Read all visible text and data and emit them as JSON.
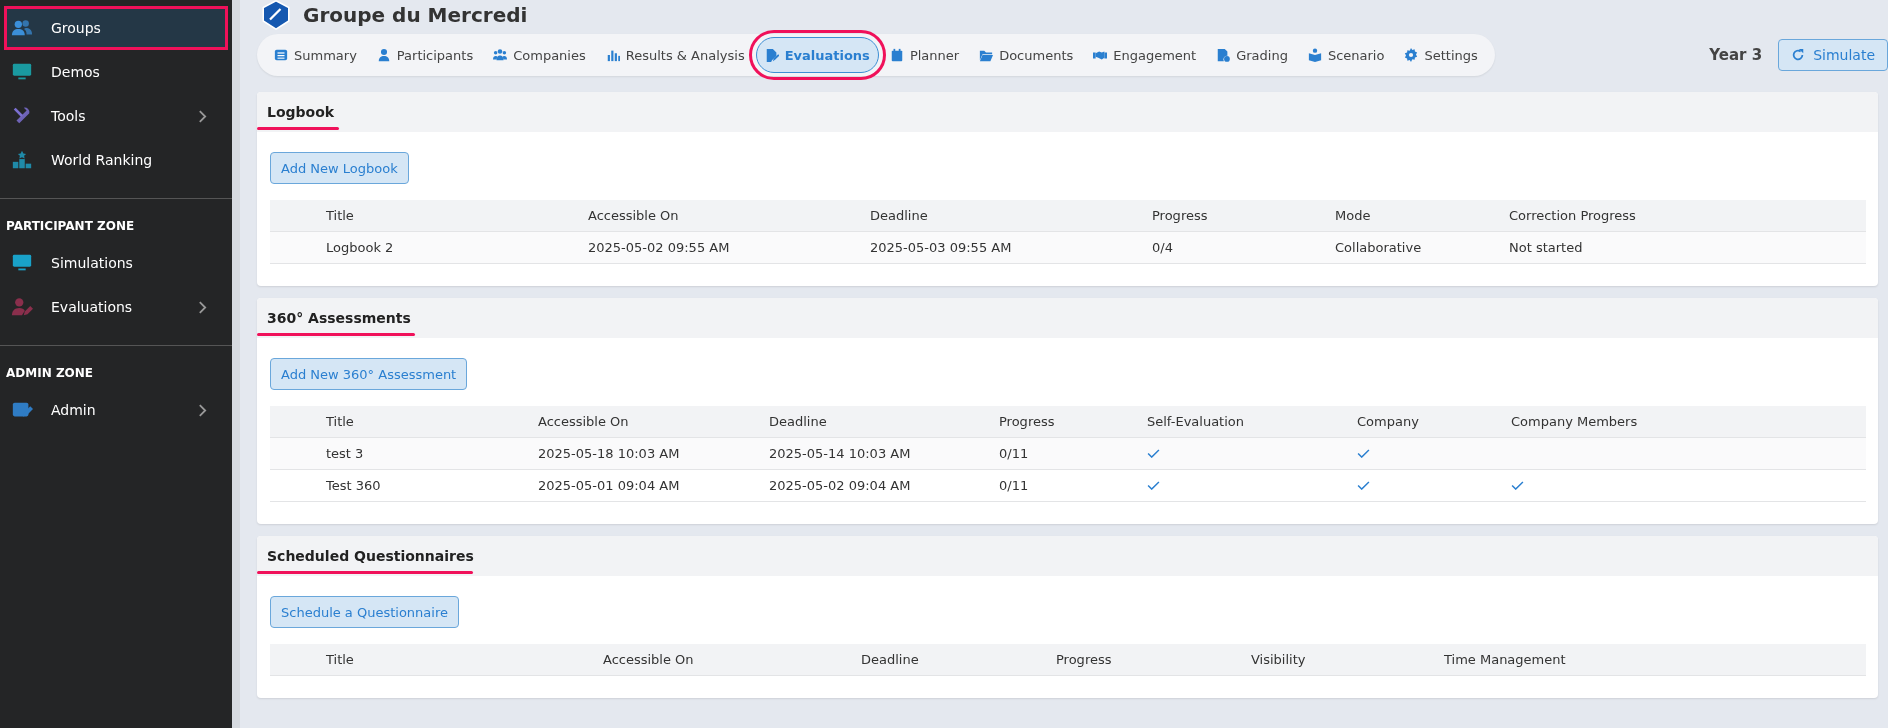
{
  "sidebar": {
    "sections": [
      {
        "items": [
          {
            "label": "Groups",
            "selected": true,
            "highlighted": true,
            "has_submenu": false
          },
          {
            "label": "Demos",
            "selected": false,
            "highlighted": false,
            "has_submenu": false
          },
          {
            "label": "Tools",
            "selected": false,
            "highlighted": false,
            "has_submenu": true
          },
          {
            "label": "World Ranking",
            "selected": false,
            "highlighted": false,
            "has_submenu": false
          }
        ]
      },
      {
        "heading": "PARTICIPANT ZONE",
        "items": [
          {
            "label": "Simulations",
            "selected": false,
            "highlighted": false,
            "has_submenu": false
          },
          {
            "label": "Evaluations",
            "selected": false,
            "highlighted": false,
            "has_submenu": true
          }
        ]
      },
      {
        "heading": "ADMIN ZONE",
        "items": [
          {
            "label": "Admin",
            "selected": false,
            "highlighted": false,
            "has_submenu": true
          }
        ]
      }
    ]
  },
  "header": {
    "title": "Groupe du Mercredi"
  },
  "tabs": [
    {
      "label": "Summary",
      "selected": false,
      "highlighted": false
    },
    {
      "label": "Participants",
      "selected": false,
      "highlighted": false
    },
    {
      "label": "Companies",
      "selected": false,
      "highlighted": false
    },
    {
      "label": "Results & Analysis",
      "selected": false,
      "highlighted": false
    },
    {
      "label": "Evaluations",
      "selected": true,
      "highlighted": true
    },
    {
      "label": "Planner",
      "selected": false,
      "highlighted": false
    },
    {
      "label": "Documents",
      "selected": false,
      "highlighted": false
    },
    {
      "label": "Engagement",
      "selected": false,
      "highlighted": false
    },
    {
      "label": "Grading",
      "selected": false,
      "highlighted": false
    },
    {
      "label": "Scenario",
      "selected": false,
      "highlighted": false
    },
    {
      "label": "Settings",
      "selected": false,
      "highlighted": false
    }
  ],
  "year": "Year 3",
  "simulate_button": "Simulate",
  "sections": [
    {
      "title": "Logbook",
      "underlined": true,
      "button": "Add New Logbook",
      "columns": [
        {
          "label": "Title",
          "kind": "text"
        },
        {
          "label": "Accessible On",
          "kind": "text"
        },
        {
          "label": "Deadline",
          "kind": "text"
        },
        {
          "label": "Progress",
          "kind": "text"
        },
        {
          "label": "Mode",
          "kind": "text"
        },
        {
          "label": "Correction Progress",
          "kind": "text"
        }
      ],
      "rows": [
        [
          "Logbook 2",
          "2025-05-02 09:55 AM",
          "2025-05-03 09:55 AM",
          "0/4",
          "Collaborative",
          "Not started"
        ]
      ]
    },
    {
      "title": "360° Assessments",
      "underlined": true,
      "button": "Add New 360° Assessment",
      "columns": [
        {
          "label": "Title",
          "kind": "text"
        },
        {
          "label": "Accessible On",
          "kind": "text"
        },
        {
          "label": "Deadline",
          "kind": "text"
        },
        {
          "label": "Progress",
          "kind": "text"
        },
        {
          "label": "Self-Evaluation",
          "kind": "check"
        },
        {
          "label": "Company",
          "kind": "check"
        },
        {
          "label": "Company Members",
          "kind": "check"
        }
      ],
      "rows": [
        [
          "test 3",
          "2025-05-18 10:03 AM",
          "2025-05-14 10:03 AM",
          "0/11",
          true,
          true,
          false
        ],
        [
          "Test 360",
          "2025-05-01 09:04 AM",
          "2025-05-02 09:04 AM",
          "0/11",
          true,
          true,
          true
        ]
      ]
    },
    {
      "title": "Scheduled Questionnaires",
      "underlined": true,
      "button": "Schedule a Questionnaire",
      "columns": [
        {
          "label": "Title"
        },
        {
          "label": "Accessible On"
        },
        {
          "label": "Deadline"
        },
        {
          "label": "Progress"
        },
        {
          "label": "Visibility"
        },
        {
          "label": "Time Management"
        }
      ]
    }
  ]
}
